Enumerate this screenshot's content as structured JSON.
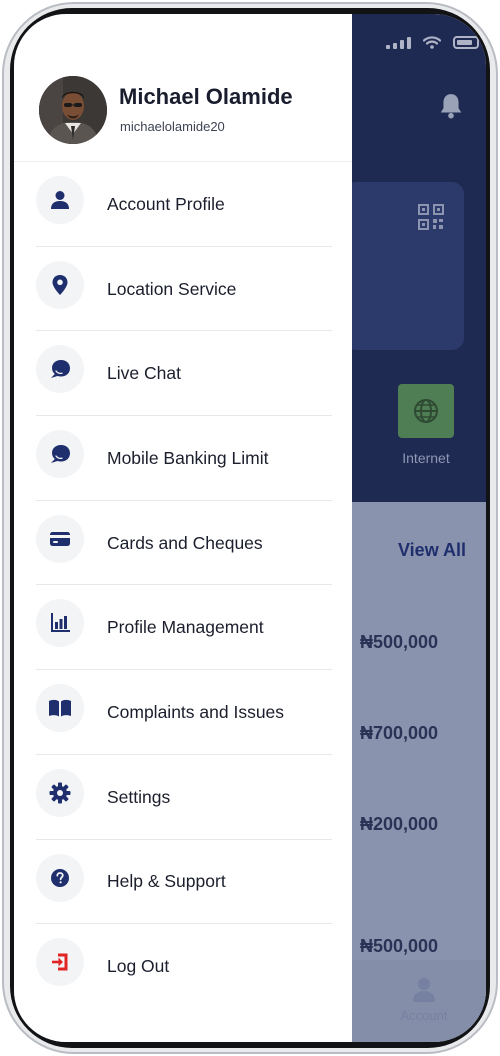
{
  "user": {
    "name": "Michael Olamide",
    "username": "michaelolamide20"
  },
  "menu": [
    {
      "label": "Account Profile",
      "icon": "person-icon"
    },
    {
      "label": "Location Service",
      "icon": "location-pin-icon"
    },
    {
      "label": "Live Chat",
      "icon": "chat-icon"
    },
    {
      "label": "Mobile Banking Limit",
      "icon": "chat-icon"
    },
    {
      "label": "Cards and Cheques",
      "icon": "card-icon"
    },
    {
      "label": "Profile Management",
      "icon": "bar-chart-icon"
    },
    {
      "label": "Complaints and Issues",
      "icon": "book-icon"
    },
    {
      "label": "Settings",
      "icon": "gear-icon"
    },
    {
      "label": "Help & Support",
      "icon": "help-icon"
    },
    {
      "label": "Log Out",
      "icon": "logout-icon"
    }
  ],
  "background": {
    "internet_label": "Internet",
    "view_all": "View All",
    "amounts": [
      "₦500,000",
      "₦700,000",
      "₦200,000",
      "₦500,000"
    ],
    "tab_account": "Account"
  },
  "colors": {
    "icon_blue": "#1f2f6e",
    "logout_red": "#e02424",
    "overlay_dark": "#1f2a52"
  }
}
